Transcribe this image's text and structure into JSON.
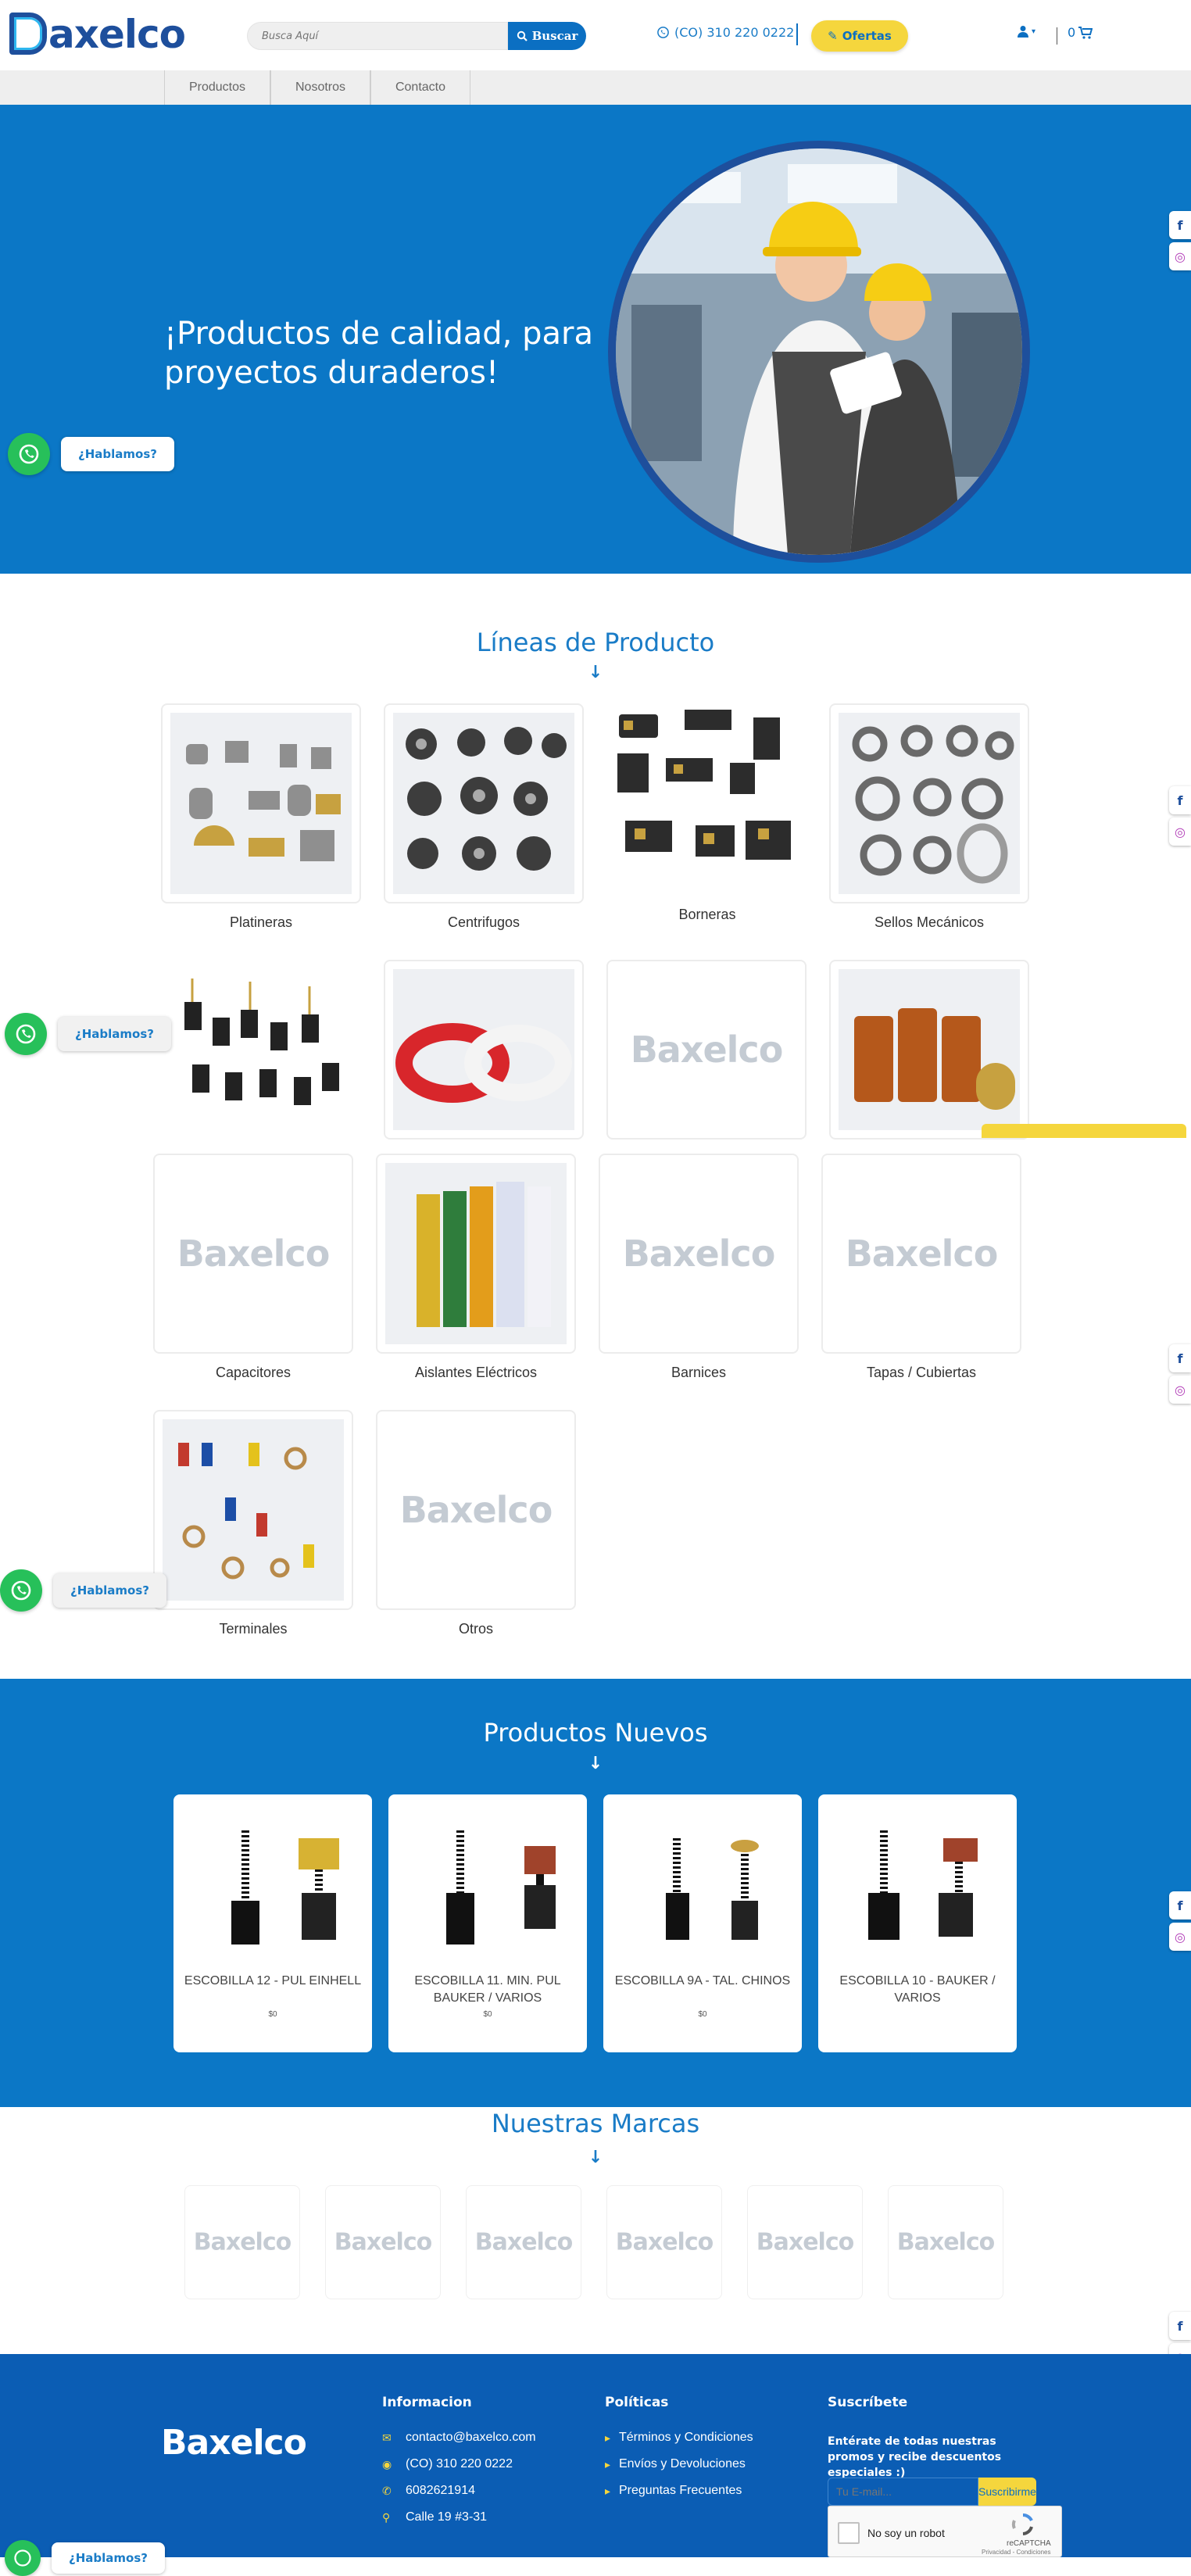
{
  "brand": {
    "logo": "Baxelco",
    "primary": "#0b77c6",
    "accent": "#f5d63d",
    "dark": "#1e4f9c"
  },
  "header": {
    "search_placeholder": "Busca Aquí",
    "search_button": "Buscar",
    "phone": "(CO) 310 220 0222",
    "ofertas": "Ofertas",
    "cart_count": "0"
  },
  "nav": {
    "items": [
      "Productos",
      "Nosotros",
      "Contacto"
    ]
  },
  "hero": {
    "title": "¡Productos de calidad, para proyectos duraderos!"
  },
  "whatsapp": {
    "label": "¿Hablamos?"
  },
  "lineas": {
    "title": "Líneas de Producto",
    "items": [
      "Platineras",
      "Centrifugos",
      "Borneras",
      "Sellos Mecánicos",
      "Capacitores",
      "Aislantes Eléctricos",
      "Barnices",
      "Tapas / Cubiertas",
      "Terminales",
      "Otros"
    ]
  },
  "nuevos": {
    "title": "Productos Nuevos",
    "products": [
      {
        "name": "ESCOBILLA 12 - PUL EINHELL",
        "price": "$0"
      },
      {
        "name": "ESCOBILLA 11. MIN. PUL BAUKER / VARIOS",
        "price": "$0"
      },
      {
        "name": "ESCOBILLA 9A - TAL. CHINOS",
        "price": "$0"
      },
      {
        "name": "ESCOBILLA 10 - BAUKER / VARIOS",
        "price": ""
      }
    ]
  },
  "marcas": {
    "title": "Nuestras Marcas"
  },
  "footer": {
    "info_title": "Informacion",
    "info": [
      "contacto@baxelco.com",
      "(CO) 310 220 0222",
      "6082621914",
      "Calle 19 #3-31"
    ],
    "policies_title": "Políticas",
    "policies": [
      "Términos y Condiciones",
      "Envíos y Devoluciones",
      "Preguntas Frecuentes"
    ],
    "subscribe_title": "Suscríbete",
    "subscribe_text": "Entérate de todas nuestras promos y recibe descuentos especiales :)",
    "email_placeholder": "Tu E-mail...",
    "subscribe_button": "Suscribirme",
    "captcha_label": "No soy un robot",
    "captcha_brand": "reCAPTCHA",
    "captcha_links": "Privacidad - Condiciones"
  }
}
